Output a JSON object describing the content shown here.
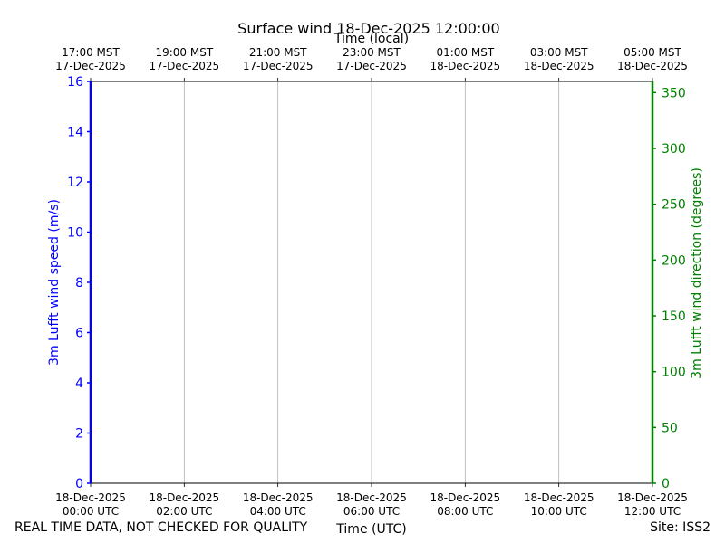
{
  "chart_data": {
    "type": "line",
    "title": "Surface wind 18-Dec-2025 12:00:00",
    "x_top_label": "Time (local)",
    "x_bottom_label": "Time (UTC)",
    "x_ticks_utc": [
      [
        "18-Dec-2025",
        "00:00 UTC"
      ],
      [
        "18-Dec-2025",
        "02:00 UTC"
      ],
      [
        "18-Dec-2025",
        "04:00 UTC"
      ],
      [
        "18-Dec-2025",
        "06:00 UTC"
      ],
      [
        "18-Dec-2025",
        "08:00 UTC"
      ],
      [
        "18-Dec-2025",
        "10:00 UTC"
      ],
      [
        "18-Dec-2025",
        "12:00 UTC"
      ]
    ],
    "x_ticks_local": [
      [
        "17:00 MST",
        "17-Dec-2025"
      ],
      [
        "19:00 MST",
        "17-Dec-2025"
      ],
      [
        "21:00 MST",
        "17-Dec-2025"
      ],
      [
        "23:00 MST",
        "17-Dec-2025"
      ],
      [
        "01:00 MST",
        "18-Dec-2025"
      ],
      [
        "03:00 MST",
        "18-Dec-2025"
      ],
      [
        "05:00 MST",
        "18-Dec-2025"
      ]
    ],
    "xlim": [
      "18-Dec-2025 00:00 UTC",
      "18-Dec-2025 12:00 UTC"
    ],
    "y_left": {
      "label": "3m Lufft wind speed (m/s)",
      "ticks": [
        0,
        2,
        4,
        6,
        8,
        10,
        12,
        14,
        16
      ],
      "ylim": [
        0,
        16
      ],
      "color": "#0000ff"
    },
    "y_right": {
      "label": "3m Lufft wind direction (degrees)",
      "ticks": [
        0,
        50,
        100,
        150,
        200,
        250,
        300,
        350
      ],
      "ylim": [
        0,
        360
      ],
      "color": "#008000"
    },
    "series": [],
    "grid": "vertical"
  },
  "footer": {
    "left": "REAL TIME DATA, NOT CHECKED FOR QUALITY",
    "right": "Site: ISS2"
  }
}
